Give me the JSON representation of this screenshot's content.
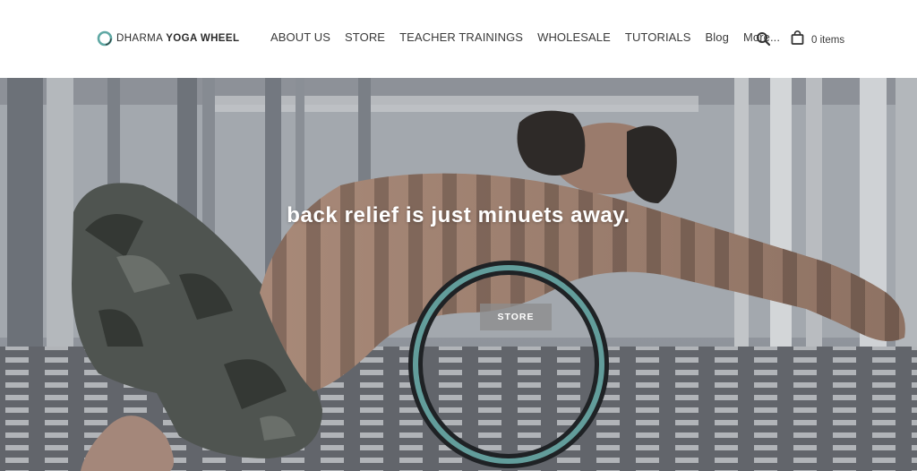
{
  "header": {
    "logo": {
      "prefix": "DHARMA",
      "brand": "YOGA WHEEL"
    },
    "nav": [
      {
        "label": "ABOUT US"
      },
      {
        "label": "STORE"
      },
      {
        "label": "TEACHER TRAININGS"
      },
      {
        "label": "WHOLESALE"
      },
      {
        "label": "TUTORIALS"
      },
      {
        "label": "Blog"
      },
      {
        "label": "More..."
      }
    ],
    "search_icon": "search-icon",
    "cart": {
      "icon": "shopping-bag-icon",
      "label": "0 items"
    }
  },
  "hero": {
    "headline": "back relief is just minuets away.",
    "button_label": "STORE"
  },
  "colors": {
    "logo_teal": "#5fa8a4",
    "header_bg": "#ffffff",
    "hero_text": "#ffffff",
    "wheel_teal": "#6fb3b0"
  }
}
